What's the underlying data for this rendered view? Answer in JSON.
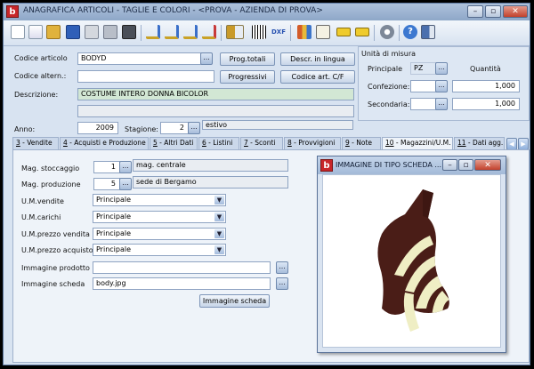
{
  "window": {
    "title": "ANAGRAFICA ARTICOLI - TAGLIE E COLORI - <PROVA - AZIENDA DI PROVA>",
    "logo_letter": "b"
  },
  "toolbar": {
    "icons": [
      "new-doc-icon",
      "copy-doc-icon",
      "open-icon",
      "save-icon",
      "print-icon",
      "delete-icon",
      "binoculars-icon",
      "edit-icon",
      "edit-search-icon",
      "edit-check-icon",
      "edit-cancel-icon",
      "grid-menu-icon",
      "barcode-icon",
      "dxf-icon",
      "books-icon",
      "notes-icon",
      "measure-icon",
      "tape-icon",
      "settings-icon",
      "help-icon",
      "exit-icon"
    ]
  },
  "form": {
    "codice_articolo_label": "Codice articolo",
    "codice_articolo": "BODYD",
    "codice_altern_label": "Codice altern.:",
    "codice_altern": "",
    "descrizione_label": "Descrizione:",
    "descrizione": "COSTUME INTERO DONNA BICOLOR",
    "descrizione2": "",
    "anno_label": "Anno:",
    "anno": "2009",
    "stagione_label": "Stagione:",
    "stagione": "2",
    "stagione_desc": "estivo",
    "btn_prog_totali": "Prog.totali",
    "btn_descr_lingua": "Descr. in lingua",
    "btn_progressivi": "Progressivi",
    "btn_codice_art_cf": "Codice art. C/F"
  },
  "unita": {
    "title": "Unità di misura",
    "principale_label": "Principale",
    "principale": "PZ",
    "quantita_label": "Quantità",
    "confezione_label": "Confezione:",
    "confezione_value": "1,000",
    "secondaria_label": "Secondaria:",
    "secondaria_value": "1,000"
  },
  "tabs": [
    {
      "num": "3",
      "label": " - Vendite"
    },
    {
      "num": "4",
      "label": " - Acquisti e Produzione"
    },
    {
      "num": "5",
      "label": " - Altri Dati"
    },
    {
      "num": "6",
      "label": " - Listini"
    },
    {
      "num": "7",
      "label": " - Sconti"
    },
    {
      "num": "8",
      "label": " - Provvigioni"
    },
    {
      "num": "9",
      "label": " - Note"
    },
    {
      "num": "10",
      "label": " - Magazzini/U.M."
    },
    {
      "num": "11",
      "label": " - Dati agg."
    }
  ],
  "panel": {
    "mag_stoccaggio_label": "Mag. stoccaggio",
    "mag_stoccaggio": "1",
    "mag_stoccaggio_desc": "mag. centrale",
    "mag_produzione_label": "Mag. produzione",
    "mag_produzione": "5",
    "mag_produzione_desc": "sede di Bergamo",
    "um_vendite_label": "U.M.vendite",
    "um_vendite": "Principale",
    "um_carichi_label": "U.M.carichi",
    "um_carichi": "Principale",
    "um_prezzo_vendita_label": "U.M.prezzo vendita",
    "um_prezzo_vendita": "Principale",
    "um_prezzo_acquisto_label": "U.M.prezzo acquisto",
    "um_prezzo_acquisto": "Principale",
    "immagine_prodotto_label": "Immagine prodotto",
    "immagine_prodotto": "",
    "immagine_scheda_label": "Immagine scheda",
    "immagine_scheda": "body.jpg",
    "btn_immagine_scheda": "Immagine scheda"
  },
  "popup": {
    "title": "IMMAGINE DI TIPO SCHEDA ...",
    "logo_letter": "b"
  },
  "colors": {
    "swimsuit_dark": "#4a1d17",
    "swimsuit_cream": "#efeec4",
    "readonly_green": "#d2e7d4"
  }
}
